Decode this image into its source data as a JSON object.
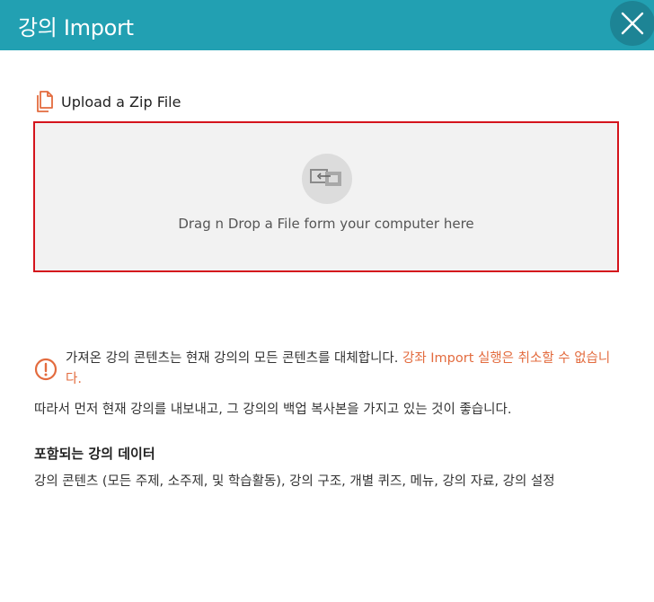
{
  "header": {
    "title": "강의 Import",
    "close_icon": "close-icon"
  },
  "upload": {
    "label": "Upload a Zip File",
    "icon": "documents-icon",
    "dropzone_text": "Drag n Drop a File form your computer here",
    "dropzone_icon": "file-transfer-icon"
  },
  "warning": {
    "icon": "exclamation-circle-icon",
    "text": "가져온 강의 콘텐츠는 현재 강의의 모든 콘텐츠를 대체합니다. ",
    "accent_text": "강좌 Import 실행은 취소할 수 없습니다."
  },
  "info": {
    "text": "따라서 먼저 현재 강의를 내보내고, 그 강의의 백업 복사본을 가지고 있는 것이 좋습니다."
  },
  "included": {
    "title": "포함되는 강의 데이터",
    "body": "강의 콘텐츠 (모든 주제, 소주제, 및 학습활동), 강의 구조, 개별 퀴즈, 메뉴, 강의 자료, 강의 설정"
  },
  "colors": {
    "header_bg": "#22a0b2",
    "close_bg": "#1d8495",
    "accent": "#e36b3e",
    "dropzone_border": "#d4141c",
    "dropzone_bg": "#f2f2f2"
  }
}
